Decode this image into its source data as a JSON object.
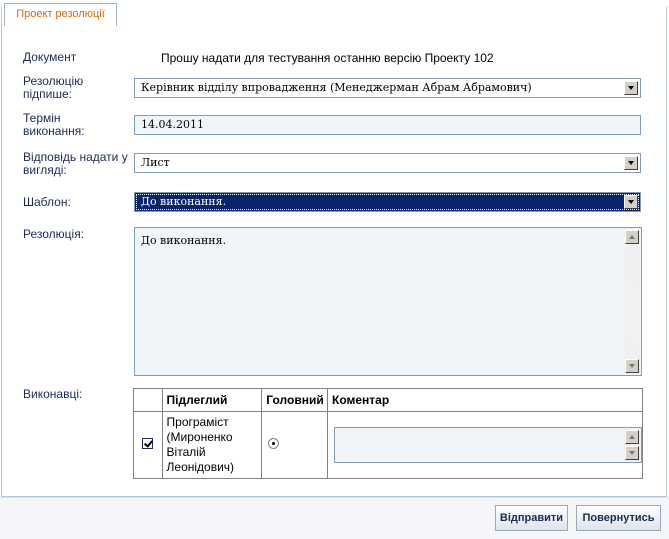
{
  "tab": {
    "title": "Проект резолюції"
  },
  "form": {
    "document": {
      "label": "Документ",
      "value": "Прошу надати для тестування останню версію Проекту 102"
    },
    "signer": {
      "label": "Резолюцію підпише:",
      "value": "Керівник відділу впровадження (Менеджерман Абрам Абрамович)"
    },
    "deadline": {
      "label": "Термін виконання:",
      "value": "14.04.2011"
    },
    "reply_form": {
      "label": "Відповідь надати у вигляді:",
      "value": "Лист"
    },
    "template": {
      "label": "Шаблон:",
      "value": "До виконання."
    },
    "resolution": {
      "label": "Резолюція:",
      "value": "До виконання."
    },
    "executors": {
      "label": "Виконавці:",
      "columns": [
        "Підлеглий",
        "Головний",
        "Коментар"
      ],
      "rows": [
        {
          "name": "Програміст (Мироненко Віталій Леонідович)",
          "checked": true,
          "main": true,
          "comment": ""
        }
      ]
    }
  },
  "buttons": {
    "send": "Відправити",
    "back": "Повернутись"
  }
}
